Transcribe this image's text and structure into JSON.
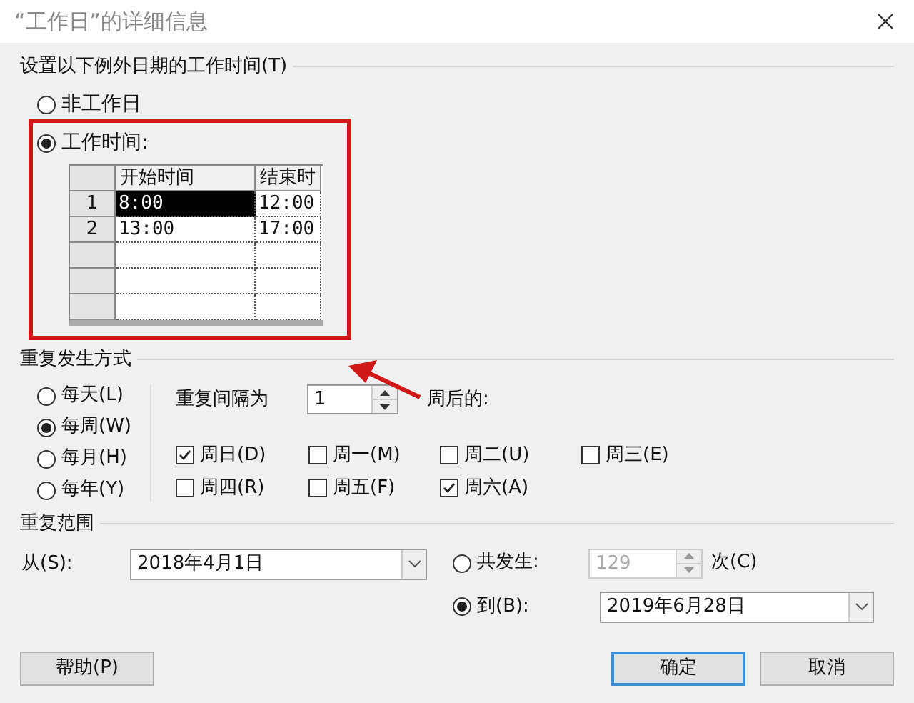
{
  "title": "“工作日”的详细信息",
  "work_time": {
    "heading": "设置以下例外日期的工作时间(T)",
    "options": [
      {
        "label": "非工作日",
        "selected": false
      },
      {
        "label": "工作时间:",
        "selected": true
      }
    ],
    "table": {
      "columns": [
        "开始时间",
        "结束时"
      ],
      "rows": [
        {
          "index": "1",
          "cells": [
            {
              "text": "8:00",
              "selected": true
            },
            {
              "text": "12:00",
              "selected": false
            }
          ]
        },
        {
          "index": "2",
          "cells": [
            {
              "text": "13:00",
              "selected": false
            },
            {
              "text": "17:00",
              "selected": false
            }
          ]
        }
      ]
    }
  },
  "recurrence": {
    "heading": "重复发生方式",
    "patterns": [
      {
        "label": "每天(L)",
        "selected": false
      },
      {
        "label": "每周(W)",
        "selected": true
      },
      {
        "label": "每月(H)",
        "selected": false
      },
      {
        "label": "每年(Y)",
        "selected": false
      }
    ],
    "interval_label": "重复间隔为",
    "interval": "1",
    "interval_suffix": "周后的:",
    "days": [
      {
        "label": "周日(D)",
        "checked": true
      },
      {
        "label": "周一(M)",
        "checked": false
      },
      {
        "label": "周二(U)",
        "checked": false
      },
      {
        "label": "周三(E)",
        "checked": false
      },
      {
        "label": "周四(R)",
        "checked": false
      },
      {
        "label": "周五(F)",
        "checked": false
      },
      {
        "label": "周六(A)",
        "checked": true
      }
    ]
  },
  "range": {
    "heading": "重复范围",
    "from_label": "从(S):",
    "from": "2018年4月1日",
    "end_options": [
      {
        "kind": "count",
        "label": "共发生:",
        "selected": false,
        "value": "129",
        "disabled": true,
        "suffix": "次(C)"
      },
      {
        "kind": "date",
        "label": "到(B):",
        "selected": true,
        "value": "2019年6月28日"
      }
    ]
  },
  "buttons": [
    {
      "label": "帮助(P)",
      "default": false
    },
    {
      "label": "确定",
      "default": true
    },
    {
      "label": "取消",
      "default": false
    }
  ]
}
